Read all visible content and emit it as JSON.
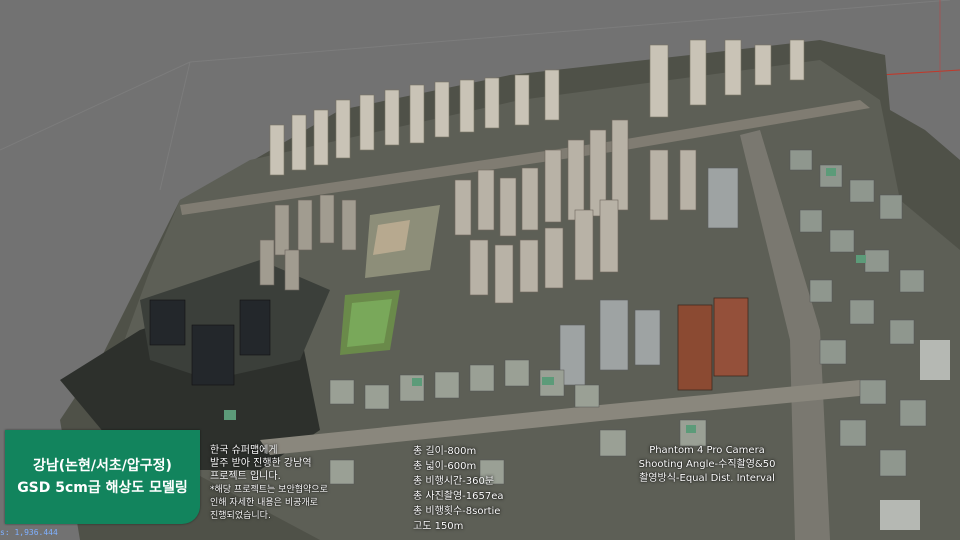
{
  "title": {
    "line1": "강남(논현/서초/압구정)",
    "line2": "GSD 5cm급 해상도 모델링"
  },
  "project": {
    "line1": "한국 슈퍼맵에게",
    "line2": "발주 받아 진행한 강남역",
    "line3": "프로젝트 입니다.",
    "note1": "*해당 프로젝트는 보안협약으로",
    "note2": "인해 자세한 내용은 비공개로",
    "note3": "진행되었습니다."
  },
  "specs": [
    "총 길이-800m",
    "총 넓이-600m",
    "총 비행시간-360분",
    "총 사진촬영-1657ea",
    "총 비행횟수-8sortie",
    "고도 150m"
  ],
  "camera": {
    "line1": "Phantom 4 Pro Camera",
    "line2": "Shooting Angle-수직촬영&50",
    "line3": "촬영방식-Equal Dist. Interval"
  },
  "viewer": {
    "scale_readout": "s: 1,936.444"
  },
  "colors": {
    "background": "#727272",
    "accent_green": "#12845d",
    "axis_red": "#c0392b"
  }
}
